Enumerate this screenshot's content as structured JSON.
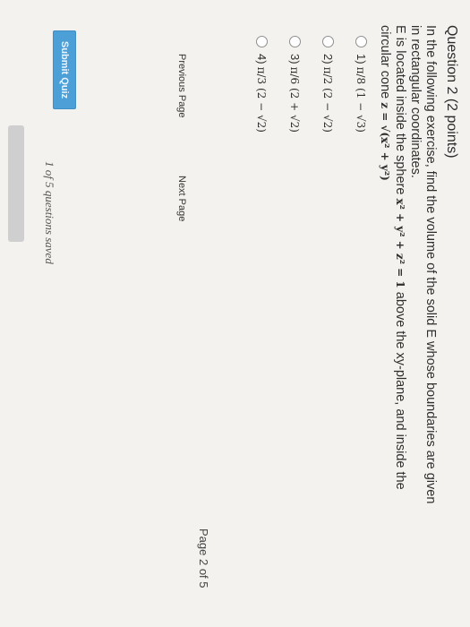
{
  "question": {
    "title": "Question 2 (2 points)",
    "line1": "In the following exercise, find the volume of the solid E whose boundaries are given",
    "line2": "in rectangular coordinates.",
    "line3_pre": "E is located inside the sphere",
    "sphere_eq": "x² + y² + z² = 1",
    "line3_post": "above the xy-plane, and inside the",
    "line4_pre": "circular cone",
    "cone_eq": "z = √(x² + y²)"
  },
  "choices": [
    {
      "num": "1)",
      "expr": "π/8 (1 − √3)"
    },
    {
      "num": "2)",
      "expr": "π/2 (2 − √2)"
    },
    {
      "num": "3)",
      "expr": "π/6 (2 + √2)"
    },
    {
      "num": "4)",
      "expr": "π/3 (2 − √2)"
    }
  ],
  "nav": {
    "previous": "Previous Page",
    "next": "Next Page"
  },
  "page_count": "Page 2 of 5",
  "submit_label": "Submit Quiz",
  "saved_status": "1 of 5 questions saved"
}
